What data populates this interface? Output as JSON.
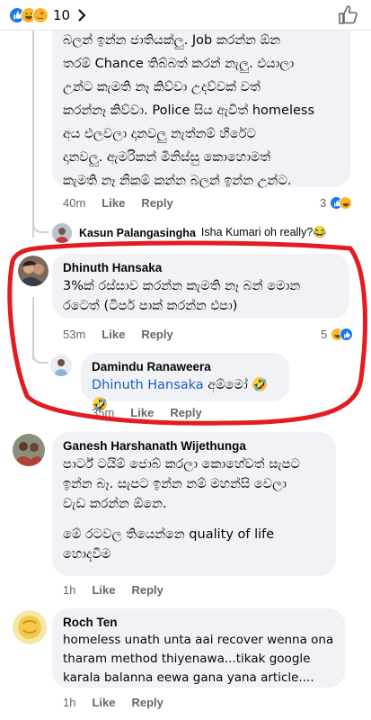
{
  "header": {
    "reaction_count": "10",
    "reaction_icons": [
      "like-icon",
      "haha-icon",
      "love-face-icon"
    ]
  },
  "top_comment": {
    "lines": [
      "බලන් ඉන්න ජාතියක්ලු. Job කරන්න ඕන",
      "තරම් Chance තිබ්බත් කරන් නැලු. එයාලා",
      "උන්ට කැමති නෑ කිව්වා උදව්වක් වත්",
      "කරන්නෑ කිව්වා. Police සිය ඇවිත් homeless",
      "අය එලවලා දානවලු නැත්නම් හිරේට",
      "දානවලු. ඇමරිකන් මිනිස්සු කොහොමත්",
      "කැමති නෑ නිකම් කන්න බලන් ඉන්න උන්ට."
    ],
    "time": "40m",
    "like": "Like",
    "reply": "Reply",
    "reactions": "3"
  },
  "reply_preview": {
    "name": "Kasun Palangasingha",
    "text": "Isha Kumari oh really?😂"
  },
  "comment_dhinuth": {
    "name": "Dhinuth Hansaka",
    "lines": [
      "3%ක් රස්සාව කරන්න කැමති නෑ බන් මොන",
      "රටෙත් (ටිපර් පාක් කරන්න එපා)"
    ],
    "time": "53m",
    "like": "Like",
    "reply": "Reply",
    "reactions": "5"
  },
  "comment_damindu": {
    "name": "Damindu Ranaweera",
    "mention": "Dhinuth Hansaka",
    "text": " අම්මෝ 🤣🤣",
    "time": "35m",
    "like": "Like",
    "reply": "Reply"
  },
  "comment_ganesh": {
    "name": "Ganesh Harshanath Wijethunga",
    "lines": [
      "පාර්ට් ටයිම් ජොබ් කරලා කොහේවත් සැපට",
      "ඉන්න බෑ. සැපට ඉන්න නම් මහන්සි වෙලා",
      "වැඩ කරන්න ඕනෙ.",
      "",
      "මේ රටවල තියෙන්නෙ quality of life",
      "හොදවීම"
    ],
    "time": "1h",
    "like": "Like",
    "reply": "Reply"
  },
  "comment_roch": {
    "name": "Roch Ten",
    "lines": [
      "homeless unath unta aai recover wenna ona",
      "tharam method thiyenawa...tikak google",
      "karala balanna eewa gana yana article...."
    ],
    "time": "1h",
    "like": "Like",
    "reply": "Reply"
  },
  "colors": {
    "accent": "#1877f2",
    "annotation_red": "#e41b23",
    "bubble_bg": "#f0f2f5",
    "meta_gray": "#65676b"
  }
}
